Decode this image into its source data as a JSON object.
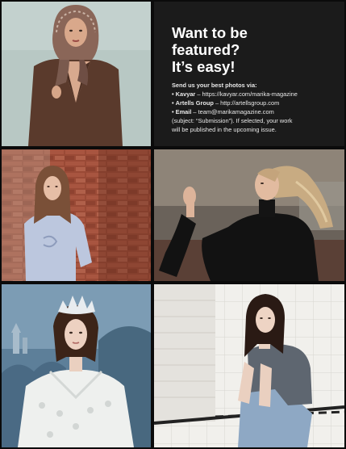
{
  "promo": {
    "title": "Want to be\nfeatured?\nIt’s easy!",
    "intro": "Send us your best photos via:",
    "bullet": "•",
    "items": [
      {
        "name": "Kavyar",
        "sep": " – ",
        "link": "https://kavyar.com/marika-magazine"
      },
      {
        "name": "Artells Group",
        "sep": " – ",
        "link": "http://artellsgroup.com"
      },
      {
        "name": "Email",
        "sep": " – ",
        "link": "team@marikamagazine.com"
      }
    ],
    "note_line1": "(subject: “Submission”). If selected, your work",
    "note_line2": "will be published in the upcoming issue."
  },
  "photos": [
    {
      "name": "woman in brown suit and patterned headscarf"
    },
    {
      "name": "woman in light blue sweatshirt against brick wall"
    },
    {
      "name": "woman in black turtleneck with flowing hair"
    },
    {
      "name": "woman in white lace dress with tiara"
    },
    {
      "name": "woman in grey t-shirt and jeans on tiled floor"
    }
  ],
  "colors": {
    "promo_background": "#1b1b1b",
    "promo_text": "#ffffff",
    "frame": "#0b0b0b"
  }
}
